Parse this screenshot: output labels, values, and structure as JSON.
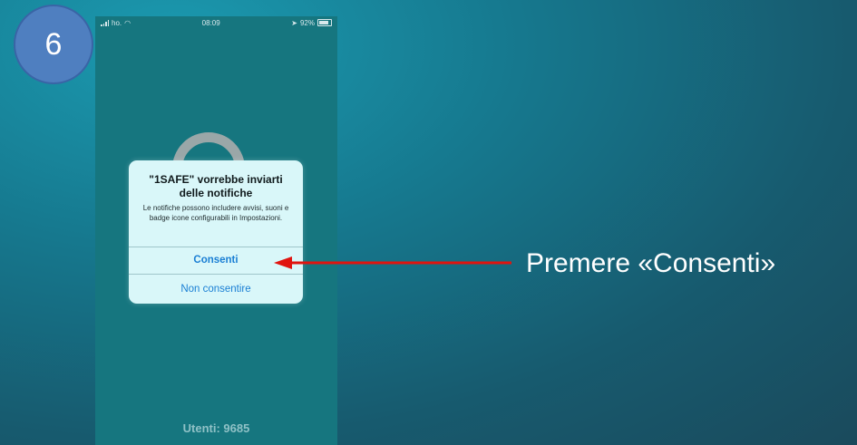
{
  "step": {
    "number": "6"
  },
  "phone": {
    "status_bar": {
      "carrier": "ho.",
      "time": "08:09",
      "battery": "92%"
    },
    "alert": {
      "title": "\"1SAFE\" vorrebbe inviarti delle notifiche",
      "message": "Le notifiche possono includere avvisi, suoni e badge icone configurabili in Impostazioni.",
      "allow_label": "Consenti",
      "deny_label": "Non consentire"
    },
    "users_label": "Utenti: 9685"
  },
  "annotation": {
    "instruction": "Premere «Consenti»",
    "arrow_color": "#e0140f"
  },
  "colors": {
    "badge": "#4f7fc0",
    "phone_background": "#16767f",
    "alert_background": "#d9f7f9",
    "alert_button": "#1a7fd4"
  }
}
